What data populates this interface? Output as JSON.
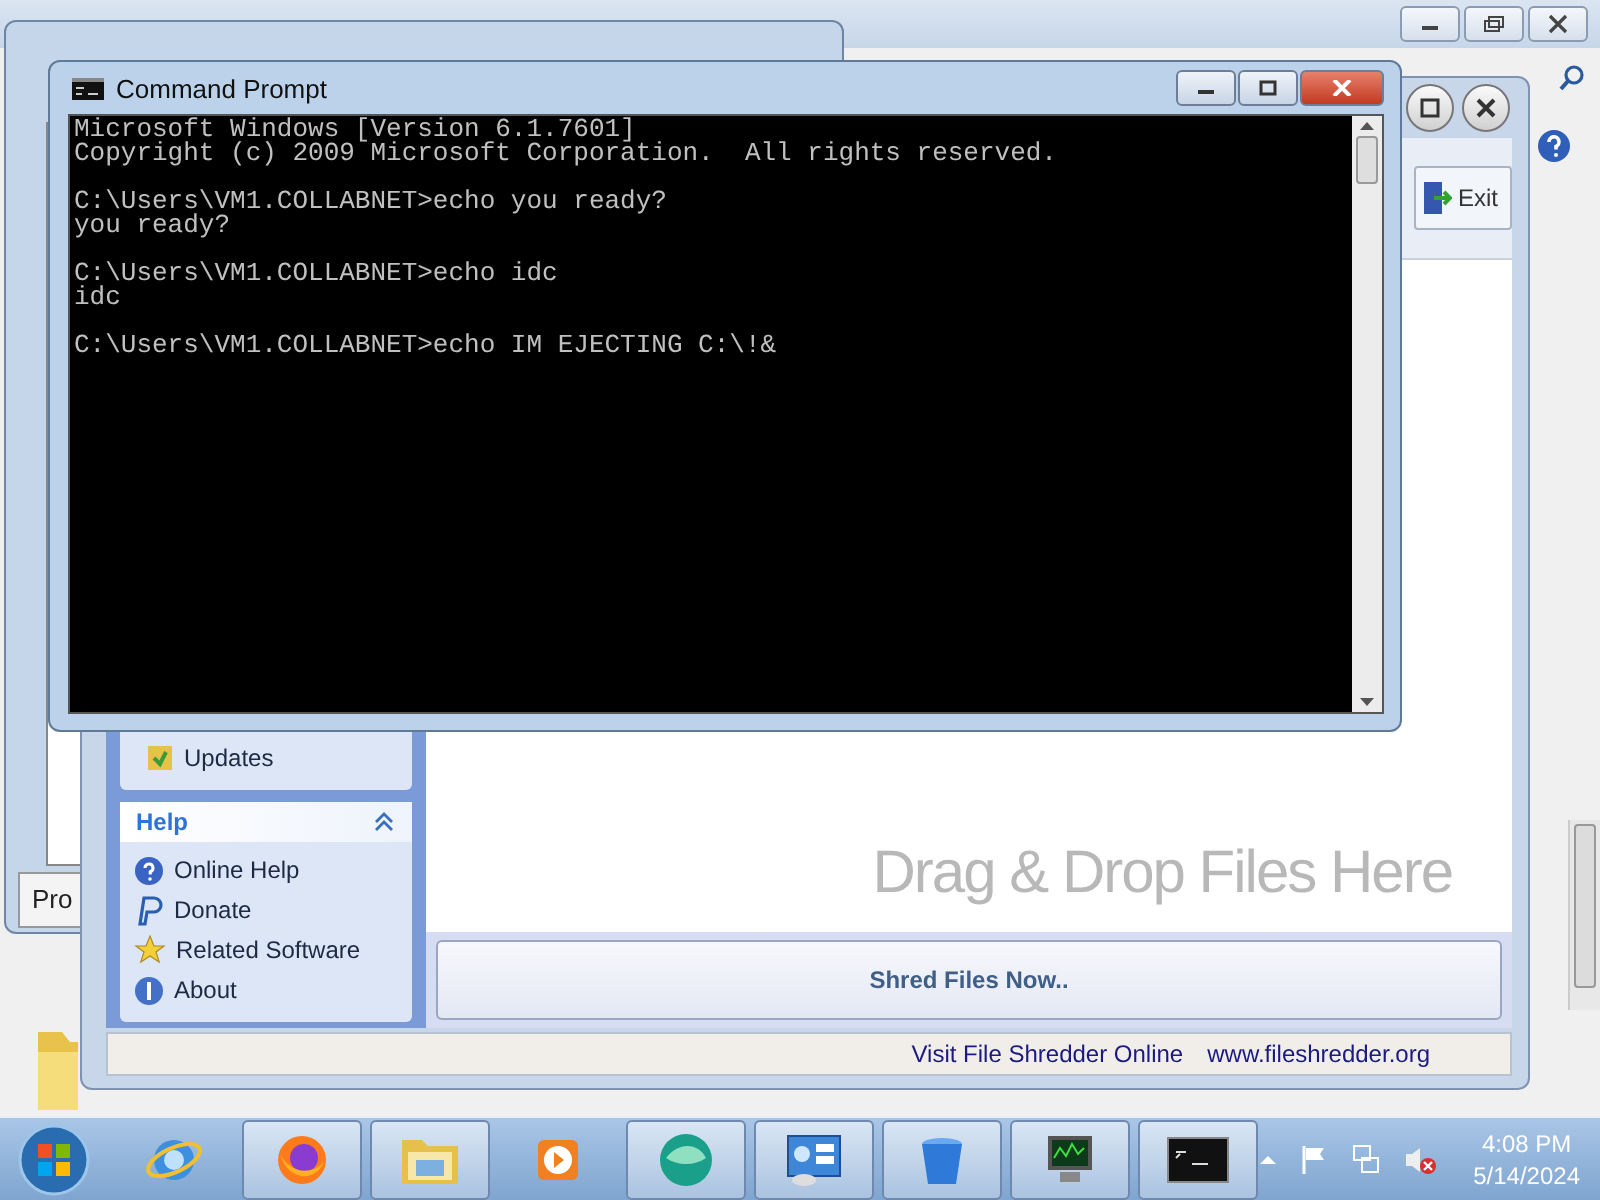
{
  "background_window": {
    "tab_label": "Pro"
  },
  "shredder": {
    "exit_button": "Exit",
    "updates_item": "Updates",
    "help_panel": {
      "title": "Help",
      "expanded": true,
      "items": [
        {
          "label": "Online Help",
          "kind": "help"
        },
        {
          "label": "Donate",
          "kind": "paypal"
        },
        {
          "label": "Related Software",
          "kind": "star"
        },
        {
          "label": "About",
          "kind": "about"
        }
      ]
    },
    "drop_hint": "Drag & Drop Files Here",
    "shred_button": "Shred Files Now..",
    "status_bar": [
      "Visit File Shredder Online",
      "www.fileshredder.org"
    ]
  },
  "command_prompt": {
    "title": "Command Prompt",
    "blocks": [
      [
        "Microsoft Windows [Version 6.1.7601]",
        "Copyright (c) 2009 Microsoft Corporation.  All rights reserved."
      ],
      [
        "C:\\Users\\VM1.COLLABNET>echo you ready?",
        "you ready?"
      ],
      [
        "C:\\Users\\VM1.COLLABNET>echo idc",
        "idc"
      ],
      [
        "C:\\Users\\VM1.COLLABNET>echo IM EJECTING C:\\!&"
      ]
    ]
  },
  "taskbar": {
    "apps": [
      {
        "kind": "ie",
        "running": false
      },
      {
        "kind": "firefox",
        "running": true
      },
      {
        "kind": "folder",
        "running": true
      },
      {
        "kind": "media",
        "running": false
      },
      {
        "kind": "green",
        "running": true
      },
      {
        "kind": "panel",
        "running": true
      },
      {
        "kind": "bin",
        "running": true
      },
      {
        "kind": "monitor",
        "running": true
      },
      {
        "kind": "console",
        "running": true
      }
    ],
    "time": "4:08 PM",
    "date": "5/14/2024"
  }
}
